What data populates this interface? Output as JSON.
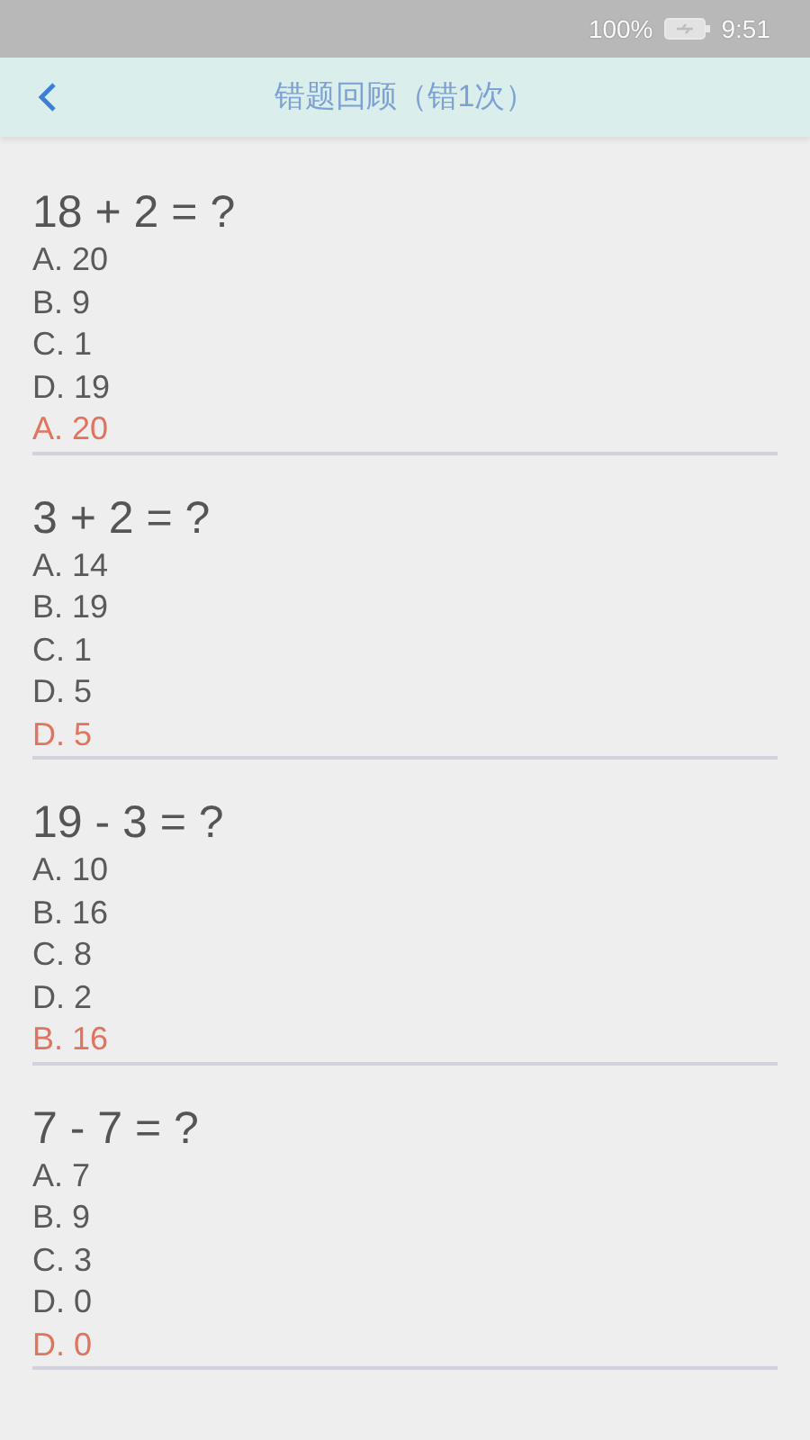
{
  "status_bar": {
    "battery_text": "100%",
    "time": "9:51"
  },
  "header": {
    "title": "错题回顾（错1次）"
  },
  "questions": [
    {
      "question": "18 + 2 = ?",
      "options": [
        "A. 20",
        "B. 9",
        "C. 1",
        "D. 19"
      ],
      "answer": "A. 20"
    },
    {
      "question": "3 + 2 = ?",
      "options": [
        "A. 14",
        "B. 19",
        "C. 1",
        "D. 5"
      ],
      "answer": "D. 5"
    },
    {
      "question": "19 - 3 = ?",
      "options": [
        "A. 10",
        "B. 16",
        "C. 8",
        "D. 2"
      ],
      "answer": "B. 16"
    },
    {
      "question": "7 - 7 = ?",
      "options": [
        "A. 7",
        "B. 9",
        "C. 3",
        "D. 0"
      ],
      "answer": "D. 0"
    }
  ]
}
